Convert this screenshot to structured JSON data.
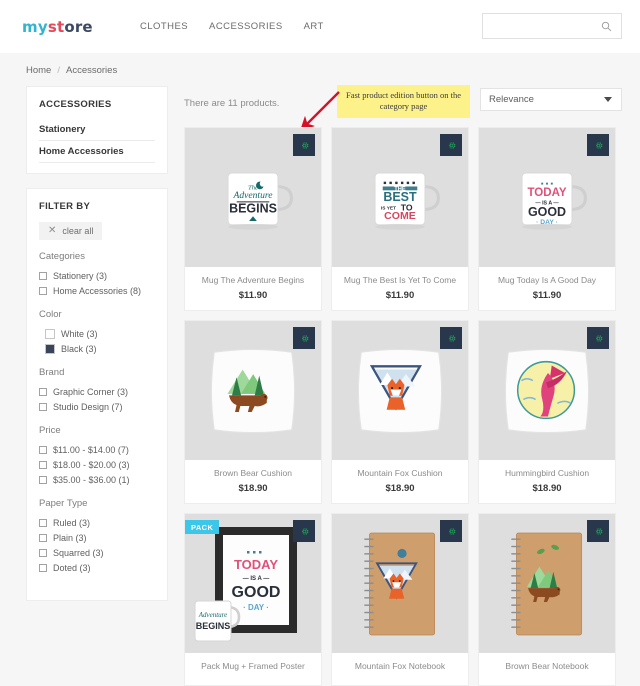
{
  "header": {
    "logo": {
      "part1": "my",
      "part2": "st",
      "part3": "ore"
    },
    "nav": [
      {
        "label": "CLOTHES"
      },
      {
        "label": "ACCESSORIES"
      },
      {
        "label": "ART"
      }
    ],
    "search": {
      "value": "",
      "placeholder": "",
      "icon": "search-icon"
    }
  },
  "breadcrumb": {
    "home": "Home",
    "separator": "/",
    "current": "Accessories"
  },
  "sidebar": {
    "category": {
      "title": "ACCESSORIES",
      "links": [
        {
          "label": "Stationery"
        },
        {
          "label": "Home Accessories"
        }
      ]
    },
    "filter": {
      "title": "FILTER BY",
      "clear_all": "clear all",
      "clear_icon": "close-icon",
      "facets": [
        {
          "name": "Categories",
          "options": [
            {
              "label": "Stationery (3)",
              "type": "checkbox"
            },
            {
              "label": "Home Accessories (8)",
              "type": "checkbox"
            }
          ]
        },
        {
          "name": "Color",
          "options": [
            {
              "label": "White (3)",
              "type": "swatch",
              "color": "#ffffff"
            },
            {
              "label": "Black (3)",
              "type": "swatch",
              "color": "#39455a"
            }
          ]
        },
        {
          "name": "Brand",
          "options": [
            {
              "label": "Graphic Corner (3)",
              "type": "checkbox"
            },
            {
              "label": "Studio Design (7)",
              "type": "checkbox"
            }
          ]
        },
        {
          "name": "Price",
          "options": [
            {
              "label": "$11.00 - $14.00 (7)",
              "type": "checkbox"
            },
            {
              "label": "$18.00 - $20.00 (3)",
              "type": "checkbox"
            },
            {
              "label": "$35.00 - $36.00 (1)",
              "type": "checkbox"
            }
          ]
        },
        {
          "name": "Paper Type",
          "options": [
            {
              "label": "Ruled (3)",
              "type": "checkbox"
            },
            {
              "label": "Plain (3)",
              "type": "checkbox"
            },
            {
              "label": "Squarred (3)",
              "type": "checkbox"
            },
            {
              "label": "Doted (3)",
              "type": "checkbox"
            }
          ]
        }
      ]
    }
  },
  "main": {
    "product_count": "There are 11 products.",
    "sort": {
      "selected": "Relevance",
      "icon": "chevron-down-icon"
    },
    "callout": {
      "text": "Fast product edition button on the category page",
      "arrow_color": "#d3122a"
    },
    "edit_button_icon": "gear-icon",
    "products": [
      {
        "name": "Mug The Adventure Begins",
        "price": "$11.90",
        "art": "mug-adventure",
        "badge": null
      },
      {
        "name": "Mug The Best Is Yet To Come",
        "price": "$11.90",
        "art": "mug-best",
        "badge": null
      },
      {
        "name": "Mug Today Is A Good Day",
        "price": "$11.90",
        "art": "mug-today",
        "badge": null
      },
      {
        "name": "Brown Bear Cushion",
        "price": "$18.90",
        "art": "cushion-bear",
        "badge": null
      },
      {
        "name": "Mountain Fox Cushion",
        "price": "$18.90",
        "art": "cushion-fox",
        "badge": null
      },
      {
        "name": "Hummingbird Cushion",
        "price": "$18.90",
        "art": "cushion-bird",
        "badge": null
      },
      {
        "name": "Pack Mug + Framed Poster",
        "price": "",
        "art": "pack-poster",
        "badge": "PACK"
      },
      {
        "name": "Mountain Fox Notebook",
        "price": "",
        "art": "notebook-fox",
        "badge": null
      },
      {
        "name": "Brown Bear Notebook",
        "price": "",
        "art": "notebook-bear",
        "badge": null
      }
    ]
  },
  "colors": {
    "page_bg": "#f6f6f6",
    "edit_button_bg": "#28374b",
    "edit_icon": "#1e9e5a",
    "pack_badge": "#3cc6e8",
    "callout_bg": "#fdf189",
    "thumb_bg": "#dedede"
  }
}
